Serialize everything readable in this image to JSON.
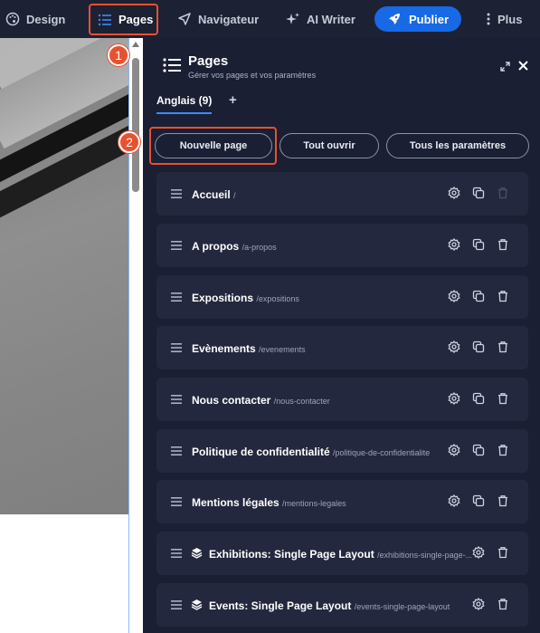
{
  "topbar": {
    "design": "Design",
    "pages": "Pages",
    "navigator": "Navigateur",
    "ai_writer": "AI Writer",
    "publish": "Publier",
    "more": "Plus"
  },
  "badges": {
    "one": "1",
    "two": "2"
  },
  "panel": {
    "title": "Pages",
    "subtitle": "Gérer vos pages et vos paramètres",
    "tab": "Anglais (9)",
    "tab_add": "+",
    "new_page": "Nouvelle page",
    "open_all": "Tout ouvrir",
    "all_settings": "Tous les paramètres"
  },
  "pages": [
    {
      "title": "Accueil",
      "slug": "/"
    },
    {
      "title": "A propos",
      "slug": "/a-propos"
    },
    {
      "title": "Expositions",
      "slug": "/expositions"
    },
    {
      "title": "Evènements",
      "slug": "/evenements"
    },
    {
      "title": "Nous contacter",
      "slug": "/nous-contacter"
    },
    {
      "title": "Politique de confidentialité",
      "slug": "/politique-de-confidentialite"
    },
    {
      "title": "Mentions légales",
      "slug": "/mentions-legales"
    },
    {
      "title": "Exhibitions: Single Page Layout",
      "slug": "/exhibitions-single-page-..."
    },
    {
      "title": "Events: Single Page Layout",
      "slug": "/events-single-page-layout"
    }
  ],
  "colors": {
    "accent": "#1769e5",
    "highlight": "#e8512f",
    "panel_bg": "#1b1f33",
    "row_bg": "#23283e"
  }
}
